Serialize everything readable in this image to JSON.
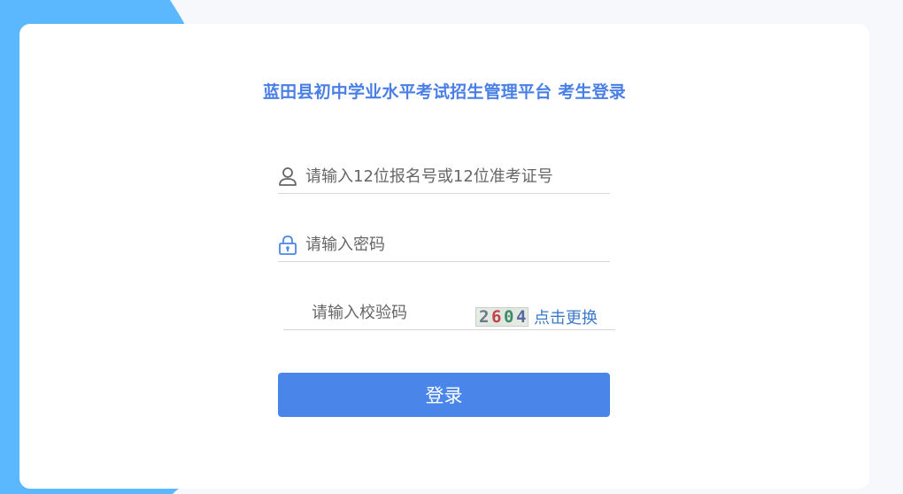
{
  "page": {
    "title": "蓝田县初中学业水平考试招生管理平台 考生登录"
  },
  "username": {
    "placeholder": "请输入12位报名号或12位准考证号",
    "icon": "user-icon"
  },
  "password": {
    "placeholder": "请输入密码",
    "icon": "lock-icon"
  },
  "captcha": {
    "placeholder": "请输入校验码",
    "code": [
      "2",
      "6",
      "0",
      "4"
    ],
    "refresh_label": "点击更换"
  },
  "login": {
    "label": "登录"
  },
  "colors": {
    "accent": "#4a86ea",
    "title": "#4a7fe6",
    "background_shape": "#5bb8ff",
    "link": "#3c79c9"
  }
}
